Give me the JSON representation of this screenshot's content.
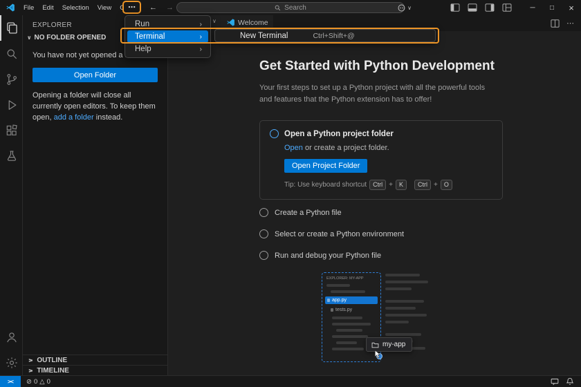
{
  "colors": {
    "accent": "#0078d4",
    "highlight": "#ec9426",
    "link": "#4daafc",
    "background": "#1f1f1f"
  },
  "glyphs": {
    "ellipsis": "⋯",
    "back": "←",
    "forward": "→",
    "chevron_down": "∨",
    "chevron_right": "›",
    "minimize": "─",
    "maximize": "□",
    "close": "×",
    "more": "⋯",
    "error": "⊘",
    "warning": "△",
    "remote": "><"
  },
  "titlebar": {
    "menus": [
      "File",
      "Edit",
      "Selection",
      "View",
      "Go"
    ],
    "search_placeholder": "Search"
  },
  "menu": {
    "items": [
      {
        "label": "Run"
      },
      {
        "label": "Terminal"
      },
      {
        "label": "Help"
      }
    ],
    "submenu": {
      "label": "New Terminal",
      "shortcut": "Ctrl+Shift+@"
    }
  },
  "tabbar": {
    "tab": "Welcome"
  },
  "sidebar": {
    "title": "EXPLORER",
    "section": "NO FOLDER OPENED",
    "empty_message": "You have not yet opened a folder.",
    "open_folder_button": "Open Folder",
    "note_before": "Opening a folder will close all currently open editors. To keep them open, ",
    "note_link": "add a folder",
    "note_after": " instead.",
    "outline": "OUTLINE",
    "timeline": "TIMELINE"
  },
  "walkthrough": {
    "title": "Get Started with Python Development",
    "subtitle": "Your first steps to set up a Python project with all the powerful tools and features that the Python extension has to offer!",
    "step1": {
      "title": "Open a Python project folder",
      "link": "Open",
      "link_rest": " or create a project folder.",
      "button": "Open Project Folder",
      "tip": "Tip: Use keyboard shortcut",
      "plus": "+",
      "keys": [
        "Ctrl",
        "K",
        "Ctrl",
        "O"
      ]
    },
    "steps": [
      "Create a Python file",
      "Select or create a Python environment",
      "Run and debug your Python file"
    ],
    "illustration": {
      "explorer_header": "EXPLORER: MY-APP",
      "file_active": "app.py",
      "file_secondary": "tests.py",
      "tooltip": "my-app"
    }
  },
  "statusbar": {
    "errors": "0",
    "warnings": "0"
  }
}
